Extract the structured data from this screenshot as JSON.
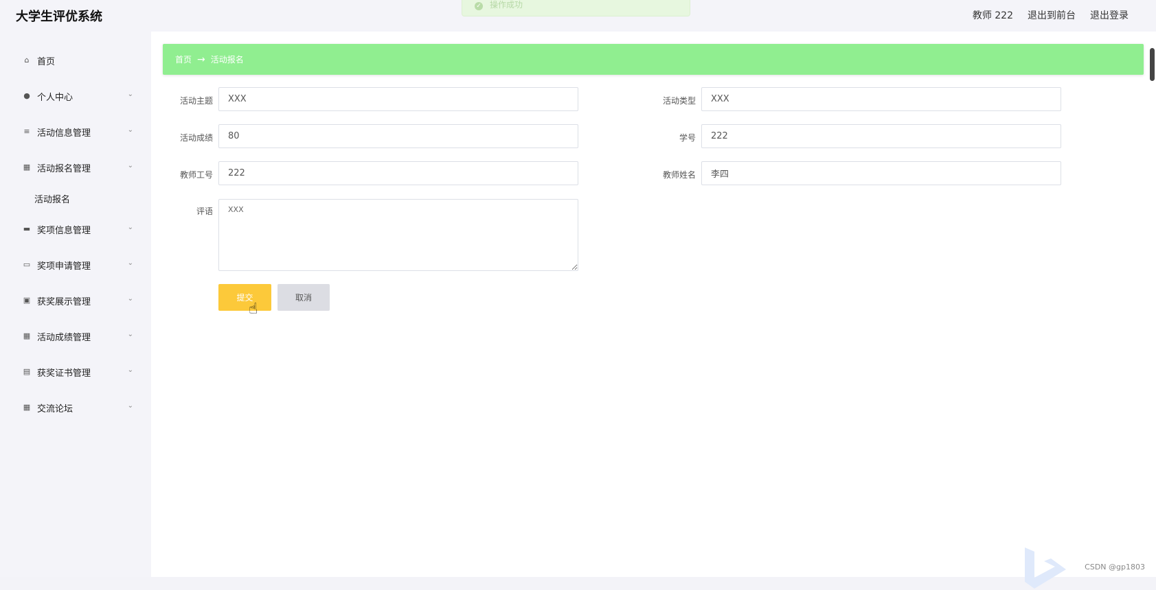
{
  "header": {
    "app_title": "大学生评优系统",
    "user_label": "教师 222",
    "exit_front": "退出到前台",
    "logout": "退出登录"
  },
  "toast": {
    "text": "操作成功"
  },
  "sidebar": {
    "items": [
      {
        "label": "首页",
        "icon": "home-icon"
      },
      {
        "label": "个人中心",
        "icon": "user-icon"
      },
      {
        "label": "活动信息管理",
        "icon": "list-icon"
      },
      {
        "label": "活动报名管理",
        "icon": "grid-icon"
      },
      {
        "label": "奖项信息管理",
        "icon": "comment-icon"
      },
      {
        "label": "奖项申请管理",
        "icon": "monitor-icon"
      },
      {
        "label": "获奖展示管理",
        "icon": "chart-icon"
      },
      {
        "label": "活动成绩管理",
        "icon": "grid-icon"
      },
      {
        "label": "获奖证书管理",
        "icon": "clipboard-icon"
      },
      {
        "label": "交流论坛",
        "icon": "grid-icon"
      }
    ],
    "submenu": {
      "label": "活动报名"
    }
  },
  "breadcrumb": {
    "home": "首页",
    "separator": "→",
    "current": "活动报名"
  },
  "form": {
    "activity_topic": {
      "label": "活动主题",
      "value": "XXX"
    },
    "activity_type": {
      "label": "活动类型",
      "value": "XXX"
    },
    "activity_score": {
      "label": "活动成绩",
      "value": "80"
    },
    "student_id": {
      "label": "学号",
      "value": "222"
    },
    "teacher_id": {
      "label": "教师工号",
      "value": "222"
    },
    "teacher_name": {
      "label": "教师姓名",
      "value": "李四"
    },
    "comment": {
      "label": "评语",
      "value": "XXX"
    },
    "submit_label": "提交",
    "cancel_label": "取消"
  },
  "footer": {
    "watermark": "CSDN @gp1803"
  },
  "colors": {
    "breadcrumb_bg": "#90ee90",
    "submit_bg": "#fcc93a",
    "cancel_bg": "#dcdde3"
  }
}
